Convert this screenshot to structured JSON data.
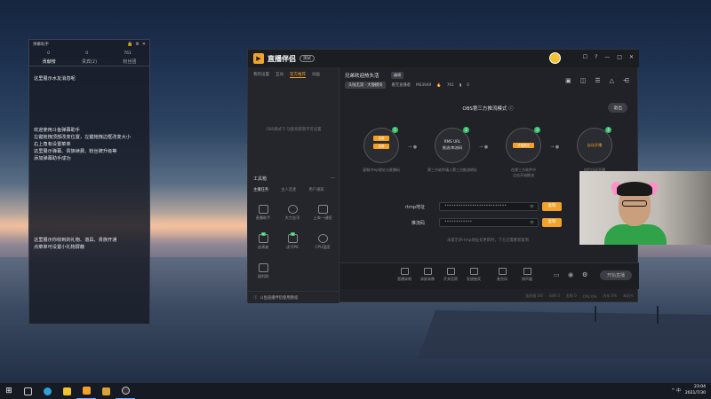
{
  "helper": {
    "title": "弹幕助手",
    "stats": {
      "left": "0",
      "mid": "0",
      "right": "761"
    },
    "tabs": [
      "贡献榜",
      "贵宾(2)",
      "粉丝团"
    ],
    "messages": [
      "这里展示水友消息呢",
      "欢迎使用斗鱼弹幕助手\n左键拖拽顶部改变位置，左键拖拽边框改变大小\n右上角有设置菜单\n这里展示弹幕、贵族续费、粉丝牌升级等\n添加弹幕助手成功",
      "这里展示你收到的礼物、道具、贵族开通\n点菜单可设置小礼物屏蔽"
    ]
  },
  "app": {
    "name": "直播伴侣",
    "version": "测试",
    "window_controls": [
      "☐",
      "?",
      "—",
      "□",
      "✕"
    ],
    "left_tabs": [
      "我的设置",
      "互动",
      "官方推荐",
      "动画"
    ],
    "left_active_tab": "官方推荐",
    "left_empty": "OBS模式下 功能场景暂不可设置",
    "tools": {
      "header": "工具箱",
      "tabs": [
        "主播任务",
        "主人连麦",
        "用户通知"
      ],
      "items": [
        "直播助手",
        "大力金币",
        "上车一键招",
        "送演者",
        "虎牙PK",
        "CPU温度",
        "福利群"
      ]
    },
    "guide": "斗鱼直播伴侣使用教程"
  },
  "room": {
    "title": "兄弟欢迎热头活",
    "edit": "编辑",
    "category": "头陆无双 · 大锤模块",
    "meta": [
      "看完直播者",
      "MS3949",
      "761",
      "0"
    ]
  },
  "obs": {
    "title": "OBS第三方推流模式",
    "exit": "退出",
    "steps": [
      {
        "num": "1",
        "buttons": [
          "复制",
          "复制"
        ],
        "caption": "复制rtmp地址与直播码"
      },
      {
        "num": "2",
        "lines": [
          "RMS URL",
          "推流/串流码"
        ],
        "caption": "第三方软件填入第三方推流地址"
      },
      {
        "num": "3",
        "buttons": [
          "开始推流"
        ],
        "caption": "在第三方软件中\n点击开始推流"
      },
      {
        "num": "4",
        "lines": [
          "自动开播"
        ],
        "caption": "伴侣自动开播"
      }
    ],
    "rtmp_label": "rtmp地址",
    "rtmp_value": "•••••••••••••••••••••••••••",
    "key_label": "推流码",
    "key_value": "••••••••••••",
    "copy": "复制",
    "hint": "未提示开rtmp地址有更新时，下方无需重新复制"
  },
  "toolbar": {
    "items": [
      "直播录制",
      "录屏录像",
      "开关话筒",
      "发放抽奖",
      "麦克风",
      "扬声器"
    ],
    "start": "开始直播",
    "status": [
      "连网速 0/0",
      "码率 0",
      "丢帧 0",
      "CPU 0%",
      "内存 0%",
      "本机卡"
    ]
  },
  "taskbar": {
    "start": "⊞",
    "time": "23:04",
    "date": "2021/7/30",
    "tray": "^ 中"
  }
}
